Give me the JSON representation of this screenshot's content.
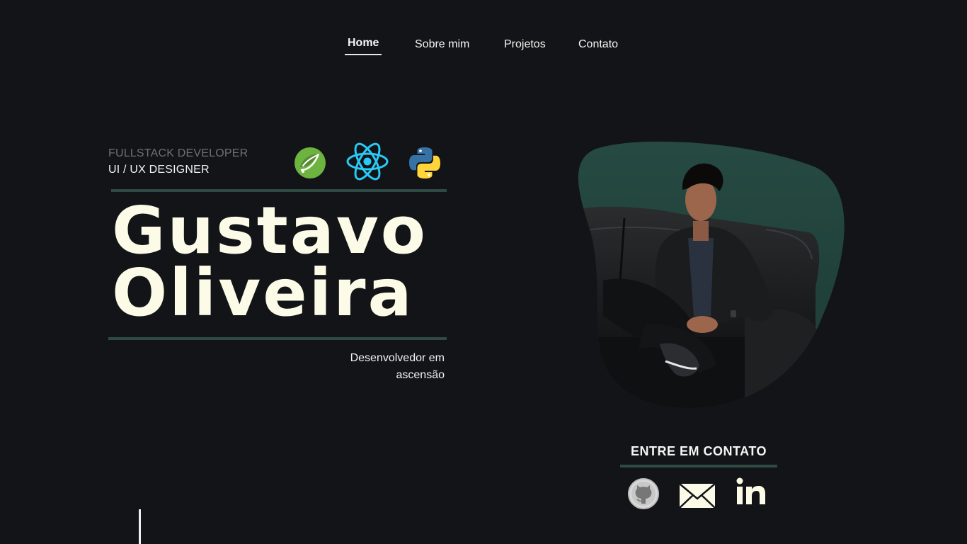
{
  "nav": {
    "items": [
      {
        "label": "Home",
        "active": true
      },
      {
        "label": "Sobre mim"
      },
      {
        "label": "Projetos"
      },
      {
        "label": "Contato"
      }
    ]
  },
  "hero": {
    "role_primary": "FULLSTACK DEVELOPER",
    "role_secondary": "UI / UX DESIGNER",
    "name_first": "Gustavo",
    "name_last": "Oliveira",
    "tagline_line1": "Desenvolvedor em",
    "tagline_line2": "ascensão",
    "tech_icons": [
      "spring-icon",
      "react-icon",
      "python-icon"
    ]
  },
  "contact": {
    "title": "ENTRE EM CONTATO",
    "links": [
      "github-icon",
      "email-icon",
      "linkedin-icon"
    ]
  },
  "colors": {
    "background": "#131417",
    "name_text": "#fcfbe8",
    "accent_rule": "#2e4a42",
    "muted_text": "#707070",
    "spring_green": "#6db33f",
    "react_blue": "#29c9f5",
    "python_blue": "#3772a4",
    "python_yellow": "#ffd43b"
  }
}
